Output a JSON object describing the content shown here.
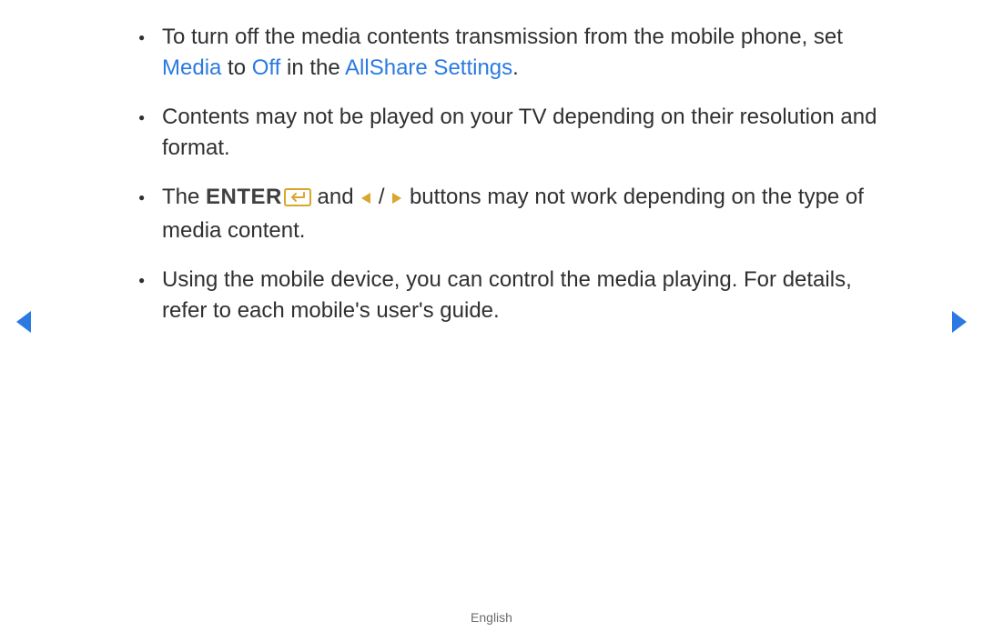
{
  "bullets": {
    "b1_pre": "To turn off the media contents transmission from the mobile phone, set ",
    "b1_media": "Media",
    "b1_to": " to ",
    "b1_off": "Off",
    "b1_in_the": " in the ",
    "b1_allshare": "AllShare Settings",
    "b1_end": ".",
    "b2": "Contents may not be played on your TV depending on their resolution and format.",
    "b3_the": "The ",
    "b3_enter": "ENTER",
    "b3_and": " and ",
    "b3_slash": " / ",
    "b3_rest": " buttons may not work depending on the type of media content.",
    "b4": "Using the mobile device, you can control the media playing. For details, refer to each mobile's user's guide."
  },
  "footer": "English",
  "icons": {
    "nav_left": "prev-page",
    "nav_right": "next-page"
  },
  "colors": {
    "blue": "#2a7ae2",
    "gold": "#d9a62e"
  }
}
